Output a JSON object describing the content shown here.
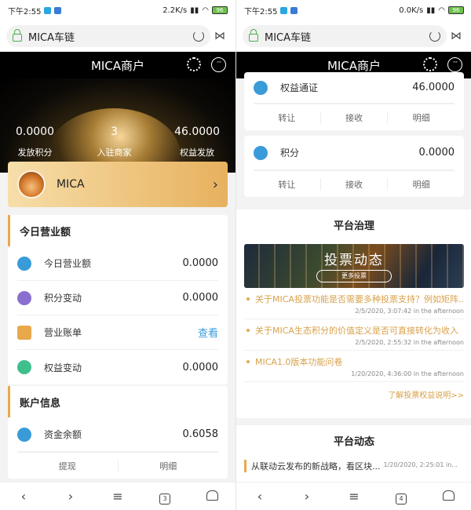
{
  "left": {
    "status": {
      "time": "下午2:55",
      "net": "2.2K/s",
      "battery": "96"
    },
    "url": "MICA车链",
    "header": "MICA商户",
    "stats": [
      {
        "value": "0.0000",
        "label": "发放积分"
      },
      {
        "value": "3",
        "label": "入驻商家"
      },
      {
        "value": "46.0000",
        "label": "权益发放"
      }
    ],
    "mica_card": {
      "name": "MICA"
    },
    "today": {
      "title": "今日营业额",
      "rows": [
        {
          "label": "今日营业额",
          "value": "0.0000",
          "icon": "coin-stack-icon",
          "color": "#3a9bd9"
        },
        {
          "label": "积分变动",
          "value": "0.0000",
          "icon": "dollar-coin-icon",
          "color": "#8a6fd0"
        },
        {
          "label": "营业账单",
          "value": "查看",
          "icon": "bill-icon",
          "color": "#e9a84b"
        },
        {
          "label": "权益变动",
          "value": "0.0000",
          "icon": "shield-coin-icon",
          "color": "#3fbf8c"
        }
      ]
    },
    "account": {
      "title": "账户信息",
      "rows": [
        {
          "label": "资金余额",
          "value": "0.6058",
          "icon": "coin-stack-icon",
          "color": "#3a9bd9"
        }
      ],
      "actions": [
        "提现",
        "明细"
      ]
    },
    "tab_count": "3"
  },
  "right": {
    "status": {
      "time": "下午2:55",
      "net": "0.0K/s",
      "battery": "96"
    },
    "url": "MICA车链",
    "header": "MICA商户",
    "token_card": {
      "label": "权益通证",
      "value": "46.0000",
      "actions": [
        "转让",
        "接收",
        "明细"
      ]
    },
    "points_card": {
      "label": "积分",
      "value": "0.0000",
      "actions": [
        "转让",
        "接收",
        "明细"
      ]
    },
    "governance": {
      "title": "平台治理",
      "banner_title": "投票动态",
      "banner_button": "更多投票",
      "votes": [
        {
          "title": "关于MICA投票功能是否需要多种投票支持？例如矩阵...",
          "time": "2/5/2020, 3:07:42 in the afternoon"
        },
        {
          "title": "关于MICA生态积分的价值定义是否可直接转化为收入",
          "time": "2/5/2020, 2:55:32 in the afternoon"
        },
        {
          "title": "MICA1.0版本功能问卷",
          "time": "1/20/2020, 4:36:00 in the afternoon"
        }
      ],
      "more_link": "了解投票权益说明>>"
    },
    "news": {
      "title": "平台动态",
      "items": [
        {
          "title": "从联动云发布的新战略，看区块...",
          "time": "1/20/2020, 2:25:01 in..."
        }
      ]
    },
    "tab_count": "4"
  }
}
